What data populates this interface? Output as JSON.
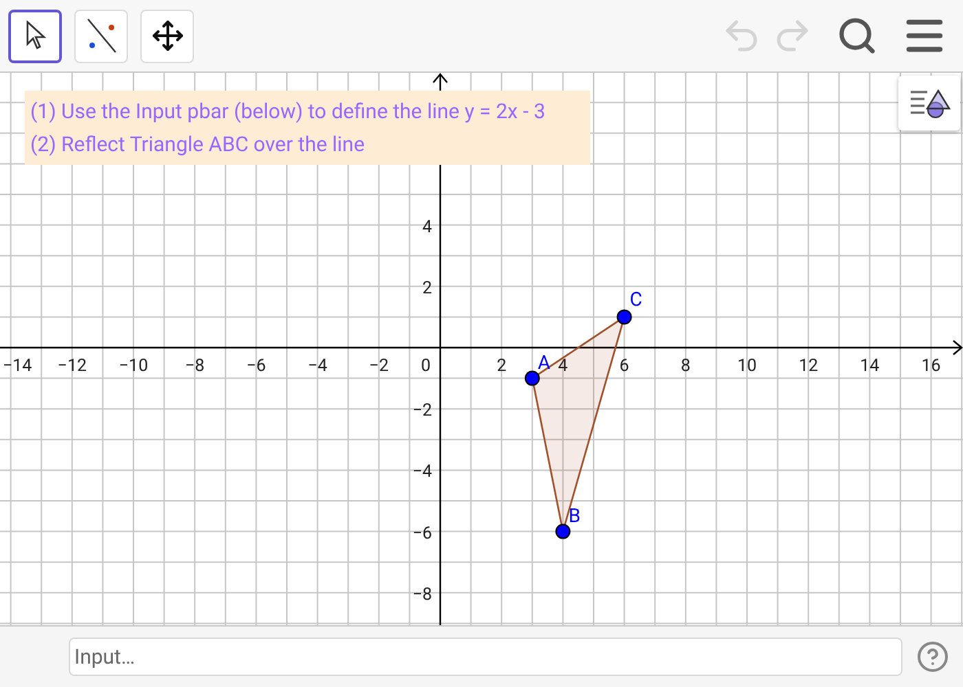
{
  "toolbar": {
    "tools": [
      {
        "kind": "pointer",
        "selected": true
      },
      {
        "kind": "line",
        "selected": false
      },
      {
        "kind": "move",
        "selected": false
      }
    ],
    "undo": {
      "disabled": true
    },
    "redo": {
      "disabled": true
    }
  },
  "instructions": [
    "(1) Use the Input pbar (below) to define the line y = 2x - 3",
    "(2) Reflect Triangle ABC over the line"
  ],
  "graph": {
    "x_tick_labels": [
      "−14",
      "−12",
      "−10",
      "−8",
      "−6",
      "−4",
      "−2",
      "2",
      "4",
      "6",
      "8",
      "10",
      "12",
      "14",
      "16"
    ],
    "y_tick_labels": [
      "4",
      "2",
      "−2",
      "−4",
      "−6",
      "−8"
    ],
    "origin_label": "0",
    "points": [
      {
        "label": "A"
      },
      {
        "label": "B"
      },
      {
        "label": "C"
      }
    ]
  },
  "input_bar": {
    "placeholder": "Input…"
  }
}
